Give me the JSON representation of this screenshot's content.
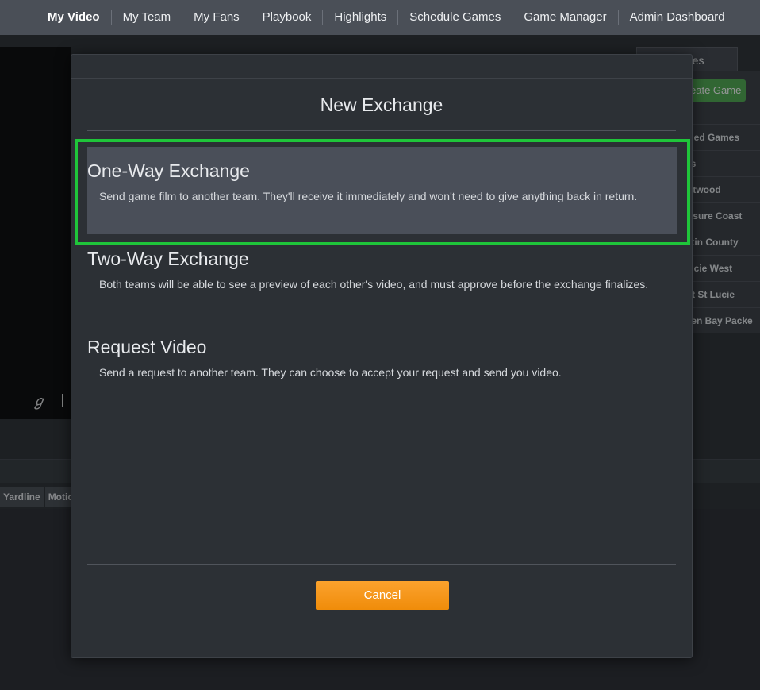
{
  "nav": {
    "items": [
      "My Video",
      "My Team",
      "My Fans",
      "Playbook",
      "Highlights",
      "Schedule Games",
      "Game Manager",
      "Admin Dashboard"
    ],
    "active": "My Video"
  },
  "background": {
    "right_tab": "mes",
    "create_button": "eate Game",
    "games": [
      "nged Games",
      "sts",
      "estwood",
      "easure Coast",
      "artin County",
      "Lucie West",
      "ort St Lucie",
      "reen Bay Packe"
    ],
    "column_headers": [
      "Yardline",
      "Motio"
    ]
  },
  "modal": {
    "title": "New Exchange",
    "options": [
      {
        "title": "One-Way Exchange",
        "description": "Send game film to another team. They'll receive it immediately and won't need to give anything back in return."
      },
      {
        "title": "Two-Way Exchange",
        "description": "Both teams will be able to see a preview of each other's video, and must approve before the exchange finalizes."
      },
      {
        "title": "Request Video",
        "description": "Send a request to another team. They can choose to accept your request and send you video."
      }
    ],
    "cancel_label": "Cancel"
  },
  "colors": {
    "accent_orange": "#f59b1c",
    "highlight_green": "#1fc53a",
    "create_green": "#4aa84a"
  }
}
